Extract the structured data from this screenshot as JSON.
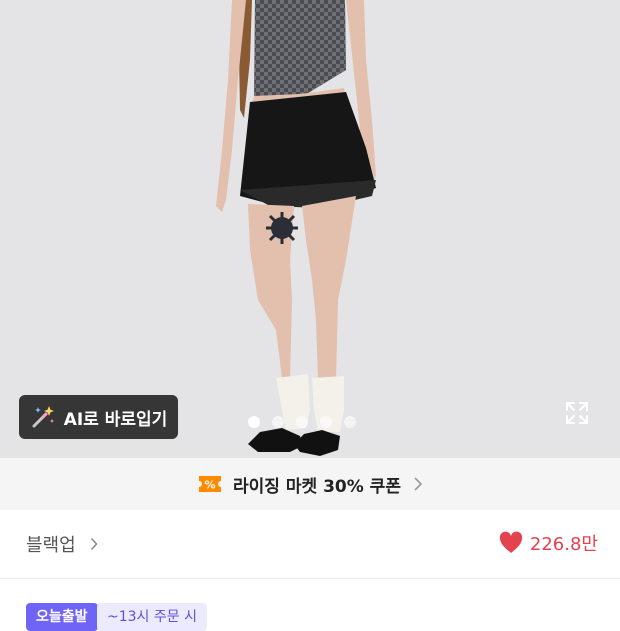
{
  "hero": {
    "ai_button_label": "AI로 바로입기",
    "carousel_dots_total": 5,
    "carousel_active_index": 1
  },
  "coupon": {
    "label": "라이징 마켓 30% 쿠폰",
    "icon_symbol": "%",
    "icon_color": "#ff8a00"
  },
  "brand": {
    "name": "블랙업",
    "like_count": "226.8만",
    "like_color": "#e4424f"
  },
  "delivery": {
    "badge_label": "오늘출발",
    "condition_text": "~13시 주문 시"
  }
}
